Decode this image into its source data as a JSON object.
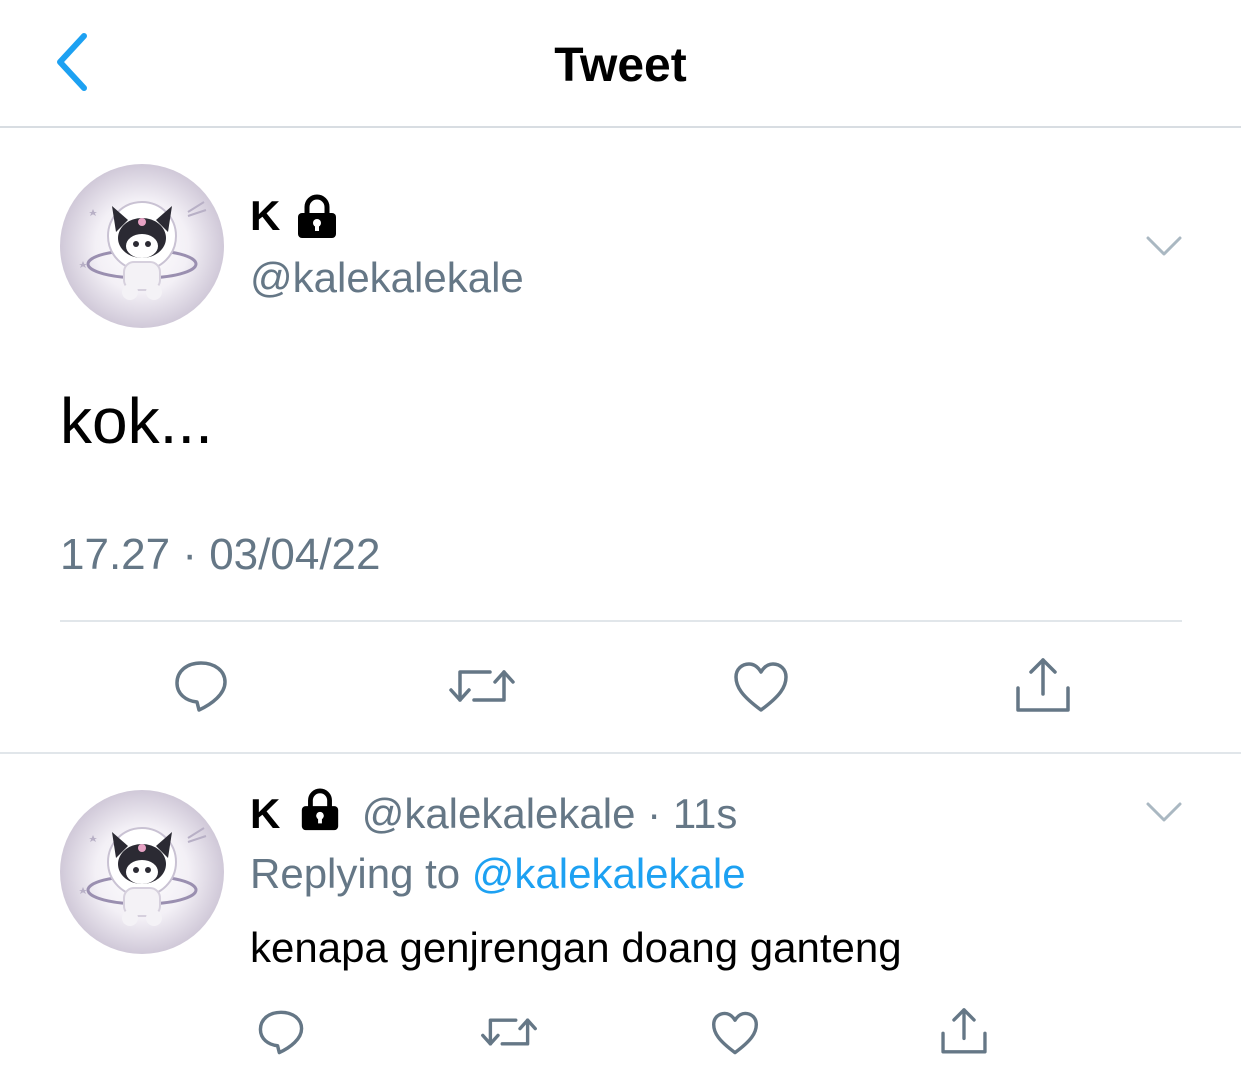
{
  "header": {
    "title": "Tweet",
    "back_icon": "chevron-left-icon"
  },
  "colors": {
    "accent": "#1da1f2",
    "secondary_text": "#657786",
    "divider": "#e1e6ea"
  },
  "main_tweet": {
    "display_name": "K",
    "handle": "@kalekalekale",
    "protected_icon": "lock-icon",
    "text": "kok...",
    "timestamp": "17.27 · 03/04/22",
    "actions": [
      "reply-icon",
      "retweet-icon",
      "like-icon",
      "share-icon"
    ]
  },
  "reply": {
    "display_name": "K",
    "handle": "@kalekalekale",
    "separator": "·",
    "age": "11s",
    "replying_prefix": "Replying to",
    "replying_to": "@kalekalekale",
    "text": "kenapa genjrengan doang ganteng",
    "actions": [
      "reply-icon",
      "retweet-icon",
      "like-icon",
      "share-icon"
    ]
  }
}
